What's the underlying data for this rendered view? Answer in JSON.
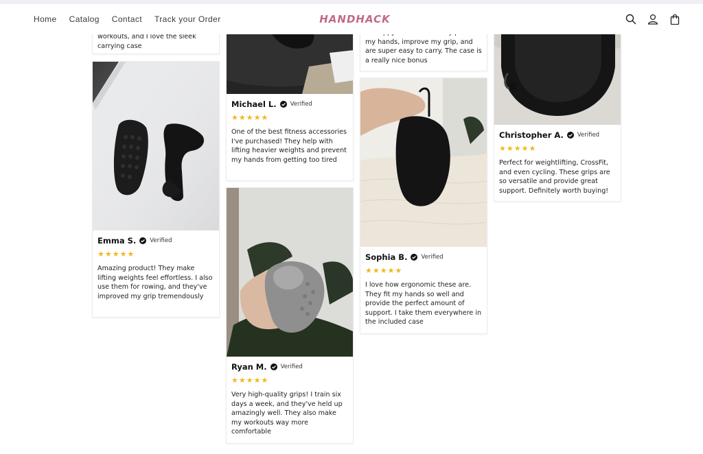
{
  "nav": {
    "home": "Home",
    "catalog": "Catalog",
    "contact": "Contact",
    "track": "Track your Order"
  },
  "brand": {
    "logo": "HANDHACK",
    "color": "#c06a85"
  },
  "header_icons": [
    "search-icon",
    "account-icon",
    "cart-icon"
  ],
  "reviews": {
    "c1_partial": {
      "text": "workouts, and I love the sleek carrying case"
    },
    "c3_partial": {
      "text": "so happy with these! They protect my hands, improve my grip, and are super easy to carry. The case is a really nice bonus"
    },
    "emma": {
      "name": "Emma S.",
      "verified": "Verified",
      "stars": "★★★★★",
      "text": "Amazing product! They make lifting weights feel effortless. I also use them for rowing, and they've improved my grip tremendously"
    },
    "michael": {
      "name": "Michael L.",
      "verified": "Verified",
      "stars": "★★★★★",
      "text": "One of the best fitness accessories I've purchased! They help with lifting heavier weights and prevent my hands from getting too tired"
    },
    "ryan": {
      "name": "Ryan M.",
      "verified": "Verified",
      "stars": "★★★★★",
      "text": "Very high-quality grips! I train six days a week, and they've held up amazingly well. They also make my workouts way more comfortable"
    },
    "sophia": {
      "name": "Sophia B.",
      "verified": "Verified",
      "stars": "★★★★★",
      "text": "I love how ergonomic these are. They fit my hands so well and provide the perfect amount of support. I take them everywhere in the included case"
    },
    "christopher": {
      "name": "Christopher A.",
      "verified": "Verified",
      "stars": "★★★★★",
      "text": "Perfect for weightlifting, CrossFit, and even cycling. These grips are so versatile and provide great support. Definitely worth buying!"
    }
  },
  "colors": {
    "star": "#f2b71c",
    "text": "#222222",
    "card_border": "#ececec"
  }
}
